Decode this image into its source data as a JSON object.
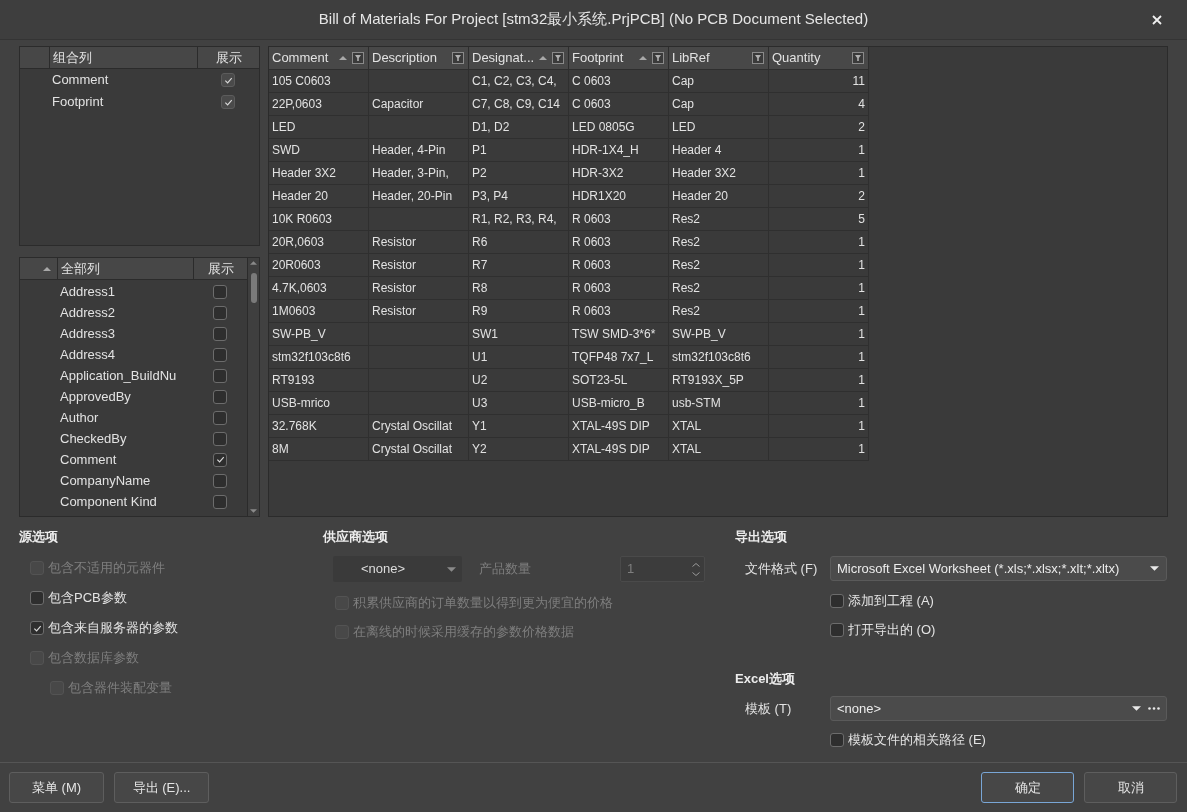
{
  "window": {
    "title": "Bill of Materials For Project [stm32最小系统.PrjPCB] (No PCB Document Selected)"
  },
  "grouped_columns": {
    "name_header": "组合列",
    "show_header": "展示",
    "items": [
      {
        "label": "Comment",
        "checked": true
      },
      {
        "label": "Footprint",
        "checked": true
      }
    ]
  },
  "all_columns": {
    "name_header": "全部列",
    "show_header": "展示",
    "sorted": true,
    "items": [
      {
        "label": "Address1",
        "checked": false
      },
      {
        "label": "Address2",
        "checked": false
      },
      {
        "label": "Address3",
        "checked": false
      },
      {
        "label": "Address4",
        "checked": false
      },
      {
        "label": "Application_BuildNu",
        "checked": false
      },
      {
        "label": "ApprovedBy",
        "checked": false
      },
      {
        "label": "Author",
        "checked": false
      },
      {
        "label": "CheckedBy",
        "checked": false
      },
      {
        "label": "Comment",
        "checked": true
      },
      {
        "label": "CompanyName",
        "checked": false
      },
      {
        "label": "Component Kind",
        "checked": false
      }
    ]
  },
  "table": {
    "columns": [
      {
        "label": "Comment",
        "sorted": true,
        "kind": "text"
      },
      {
        "label": "Description",
        "sorted": false,
        "kind": "text"
      },
      {
        "label": "Designat...",
        "sorted": true,
        "kind": "text"
      },
      {
        "label": "Footprint",
        "sorted": true,
        "kind": "text"
      },
      {
        "label": "LibRef",
        "sorted": false,
        "kind": "text"
      },
      {
        "label": "Quantity",
        "sorted": false,
        "kind": "number"
      }
    ],
    "rows": [
      {
        "comment": "105 C0603",
        "designator": "C1, C2, C3, C4,",
        "footprint": "C 0603",
        "libref": "Cap",
        "quantity": "11"
      },
      {
        "comment": "22P,0603",
        "description": "Capacitor",
        "designator": "C7, C8, C9, C14",
        "footprint": "C 0603",
        "libref": "Cap",
        "quantity": "4"
      },
      {
        "comment": "LED",
        "designator": "D1, D2",
        "footprint": "LED 0805G",
        "libref": "LED",
        "quantity": "2"
      },
      {
        "comment": "SWD",
        "description": "Header, 4-Pin",
        "designator": "P1",
        "footprint": "HDR-1X4_H",
        "libref": "Header 4",
        "quantity": "1"
      },
      {
        "comment": "Header 3X2",
        "description": "Header, 3-Pin,",
        "designator": "P2",
        "footprint": "HDR-3X2",
        "libref": "Header 3X2",
        "quantity": "1"
      },
      {
        "comment": "Header 20",
        "description": "Header, 20-Pin",
        "designator": "P3, P4",
        "footprint": "HDR1X20",
        "libref": "Header 20",
        "quantity": "2"
      },
      {
        "comment": "10K R0603",
        "designator": "R1, R2, R3, R4,",
        "footprint": "R 0603",
        "libref": "Res2",
        "quantity": "5"
      },
      {
        "comment": "20R,0603",
        "description": "Resistor",
        "designator": "R6",
        "footprint": "R 0603",
        "libref": "Res2",
        "quantity": "1"
      },
      {
        "comment": "20R0603",
        "description": "Resistor",
        "designator": "R7",
        "footprint": "R 0603",
        "libref": "Res2",
        "quantity": "1"
      },
      {
        "comment": "4.7K,0603",
        "description": "Resistor",
        "designator": "R8",
        "footprint": "R 0603",
        "libref": "Res2",
        "quantity": "1"
      },
      {
        "comment": "1M0603",
        "description": "Resistor",
        "designator": "R9",
        "footprint": "R 0603",
        "libref": "Res2",
        "quantity": "1"
      },
      {
        "comment": "SW-PB_V",
        "designator": "SW1",
        "footprint": "TSW SMD-3*6*",
        "libref": "SW-PB_V",
        "quantity": "1"
      },
      {
        "comment": "stm32f103c8t6",
        "designator": "U1",
        "footprint": "TQFP48 7x7_L",
        "libref": "stm32f103c8t6",
        "quantity": "1"
      },
      {
        "comment": "RT9193",
        "designator": "U2",
        "footprint": "SOT23-5L",
        "libref": "RT9193X_5P",
        "quantity": "1"
      },
      {
        "comment": "USB-mrico",
        "designator": "U3",
        "footprint": "USB-micro_B",
        "libref": "usb-STM",
        "quantity": "1"
      },
      {
        "comment": "32.768K",
        "description": "Crystal Oscillat",
        "designator": "Y1",
        "footprint": "XTAL-49S DIP",
        "libref": "XTAL",
        "quantity": "1"
      },
      {
        "comment": "8M",
        "description": "Crystal Oscillat",
        "designator": "Y2",
        "footprint": "XTAL-49S DIP",
        "libref": "XTAL",
        "quantity": "1"
      }
    ]
  },
  "source_options": {
    "title": "源选项",
    "items": [
      {
        "label": "包含不适用的元器件",
        "checked": false,
        "disabled": true
      },
      {
        "label": "包含PCB参数",
        "checked": false,
        "disabled": false
      },
      {
        "label": "包含来自服务器的参数",
        "checked": true,
        "disabled": false
      },
      {
        "label": "包含数据库参数",
        "checked": false,
        "disabled": true,
        "children": [
          {
            "label": "包含器件装配变量",
            "checked": false,
            "disabled": true
          }
        ]
      }
    ]
  },
  "supplier_options": {
    "title": "供应商选项",
    "supplier": "<none>",
    "quantity_label": "产品数量",
    "quantity": {
      "value": "1",
      "disabled": true
    },
    "items": [
      {
        "label": "积累供应商的订单数量以得到更为便宜的价格",
        "checked": false,
        "disabled": true
      },
      {
        "label": "在离线的时候采用缓存的参数价格数据",
        "checked": false,
        "disabled": true
      }
    ]
  },
  "export_options": {
    "title": "导出选项",
    "file_format_label": "文件格式 (F)",
    "file_format": "Microsoft Excel Worksheet (*.xls;*.xlsx;*.xlt;*.xltx)",
    "items": [
      {
        "label": "添加到工程 (A)",
        "checked": false,
        "disabled": false
      },
      {
        "label": "打开导出的 (O)",
        "checked": false,
        "disabled": false
      }
    ]
  },
  "excel_options": {
    "title": "Excel选项",
    "template_label": "模板 (T)",
    "template": "<none>",
    "items": [
      {
        "label": "模板文件的相关路径 (E)",
        "checked": false,
        "disabled": false
      }
    ]
  },
  "buttons_left": [
    {
      "label": "菜单 (M)",
      "default": false
    },
    {
      "label": "导出 (E)...",
      "default": false
    }
  ],
  "buttons_right": [
    {
      "label": "确定",
      "default": true
    },
    {
      "label": "取消",
      "default": false
    }
  ]
}
